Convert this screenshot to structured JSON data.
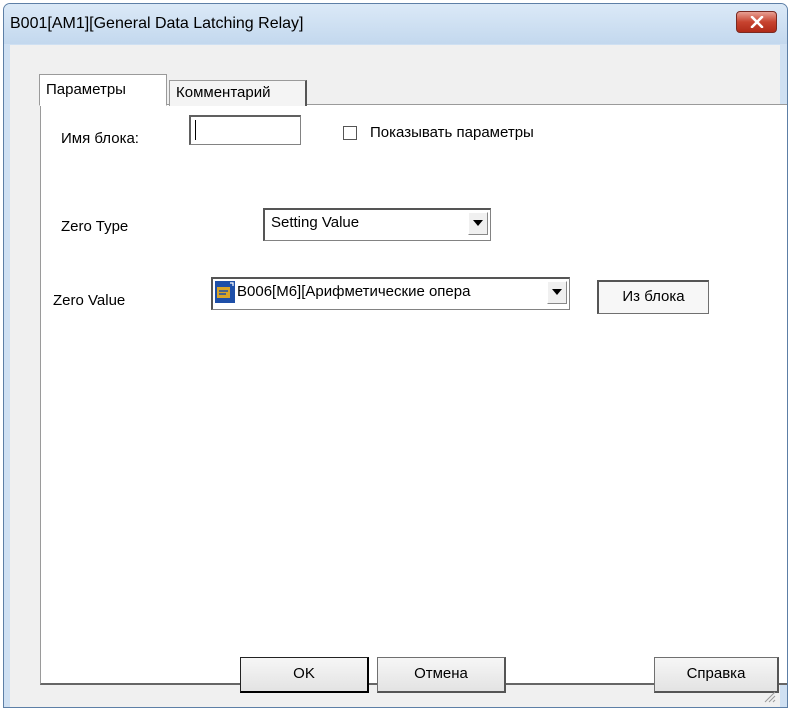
{
  "window": {
    "title": "B001[AM1][General Data Latching Relay]"
  },
  "tabs": [
    {
      "label": "Параметры",
      "active": true
    },
    {
      "label": "Комментарий",
      "active": false
    }
  ],
  "params": {
    "block_name_label": "Имя блока:",
    "block_name_value": "",
    "show_params_label": "Показывать параметры",
    "show_params_checked": false,
    "zero_type_label": "Zero Type",
    "zero_type_value": "Setting Value",
    "zero_value_label": "Zero Value",
    "zero_value_value": "B006[M6][Арифметические опера",
    "from_block_label": "Из блока"
  },
  "buttons": {
    "ok": "OK",
    "cancel": "Отмена",
    "help": "Справка"
  },
  "colors": {
    "title_bar": "#c3d8ee",
    "close_button": "#c7432f",
    "selection": "#1e4fa8"
  },
  "icons": {
    "close": "close-icon",
    "dropdown": "chevron-down-icon",
    "block": "block-icon",
    "resize": "resize-grip-icon"
  }
}
